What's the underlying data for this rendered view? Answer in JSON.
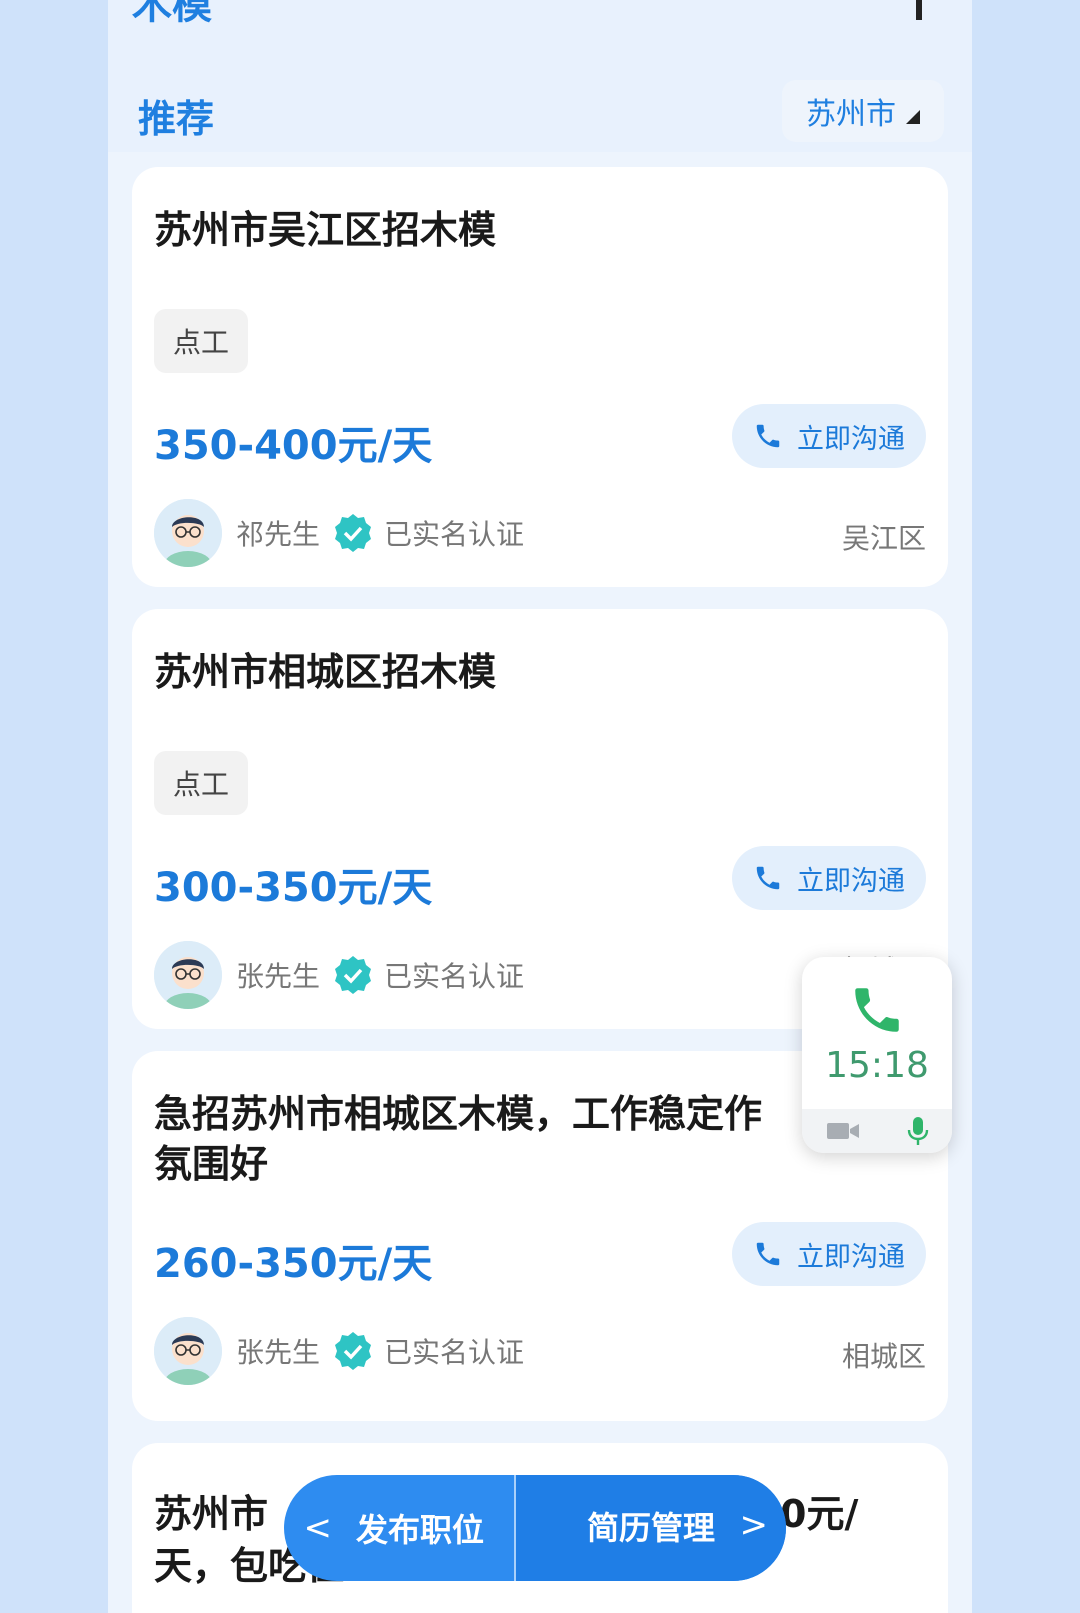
{
  "header": {
    "top_title": "木模",
    "tab_label": "推荐",
    "city": "苏州市"
  },
  "jobs": [
    {
      "title": "苏州市吴江区招木模",
      "tag": "点工",
      "salary": "350-400元/天",
      "chat_label": "立即沟通",
      "poster": "祁先生",
      "verified": "已实名认证",
      "district": "吴江区"
    },
    {
      "title": "苏州市相城区招木模",
      "tag": "点工",
      "salary": "300-350元/天",
      "chat_label": "立即沟通",
      "poster": "张先生",
      "verified": "已实名认证",
      "district": "相城区"
    },
    {
      "title": "急招苏州市相城区木模，工作稳定作氛围好",
      "salary": "260-350元/天",
      "chat_label": "立即沟通",
      "poster": "张先生",
      "verified": "已实名认证",
      "district": "相城区"
    },
    {
      "title_start": "苏州市",
      "title_end": "0元/",
      "title_line2": "天，包吃住"
    }
  ],
  "call_float": {
    "time": "15:18"
  },
  "bottom_bar": {
    "prev": "<",
    "post_job": "发布职位",
    "resume": "简历管理",
    "next": ">"
  },
  "colors": {
    "accent": "#1f7fe0",
    "verified": "#2ec4c4",
    "call_green": "#3f9a6e"
  }
}
